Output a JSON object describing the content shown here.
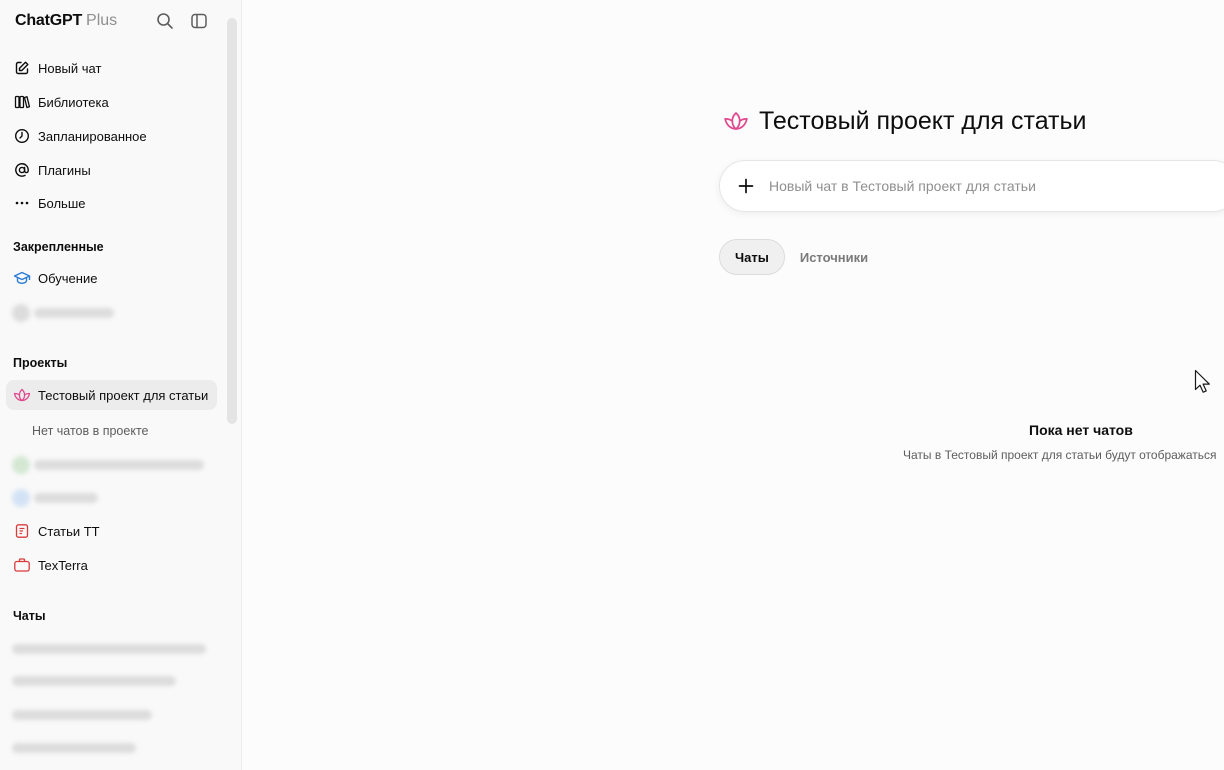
{
  "sidebar": {
    "brand": "ChatGPT",
    "plan": "Plus",
    "header_icons": [
      "search-icon",
      "sidebar-toggle-icon"
    ],
    "nav": [
      {
        "label": "Новый чат",
        "icon": "edit-icon"
      },
      {
        "label": "Библиотека",
        "icon": "library-icon"
      },
      {
        "label": "Запланированное",
        "icon": "clock-icon"
      },
      {
        "label": "Плагины",
        "icon": "at-icon"
      },
      {
        "label": "Больше",
        "icon": "more-icon"
      }
    ],
    "pinned_title": "Закрепленные",
    "pinned": [
      {
        "label": "Обучение",
        "icon": "graduation-cap-icon"
      }
    ],
    "projects_title": "Проекты",
    "projects": [
      {
        "label": "Тестовый проект для статьи",
        "icon": "lotus-icon",
        "active": true
      },
      {
        "label": "Статьи ТТ",
        "icon": "document-icon"
      },
      {
        "label": "TexTerra",
        "icon": "briefcase-icon"
      }
    ],
    "project_empty_note": "Нет чатов в проекте",
    "chats_title": "Чаты"
  },
  "main": {
    "project_title": "Тестовый проект для статьи",
    "new_chat_placeholder": "Новый чат в Тестовый проект для статьи",
    "tabs": [
      {
        "label": "Чаты",
        "selected": true
      },
      {
        "label": "Источники",
        "selected": false
      }
    ],
    "empty_title": "Пока нет чатов",
    "empty_subtitle": "Чаты в Тестовый проект для статьи будут отображаться"
  },
  "colors": {
    "accent_pink": "#e0488f",
    "learning_blue": "#2a7bd6",
    "project_red": "#d93a3a"
  }
}
